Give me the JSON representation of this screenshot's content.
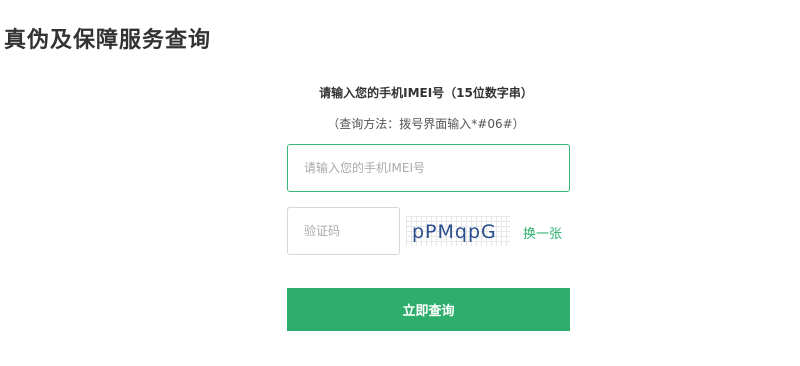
{
  "page": {
    "title": "真伪及保障服务查询"
  },
  "form": {
    "prompt": "请输入您的手机IMEI号（15位数字串）",
    "hint": "（查询方法：拨号界面输入*#06#）",
    "imei_placeholder": "请输入您的手机IMEI号",
    "captcha_placeholder": "验证码",
    "captcha_text": "pPMqpG",
    "refresh_label": "换一张",
    "submit_label": "立即查询"
  },
  "colors": {
    "accent": "#2eae6c",
    "input_focus_border": "#3bb27a",
    "captcha_text": "#2a4f8f"
  }
}
